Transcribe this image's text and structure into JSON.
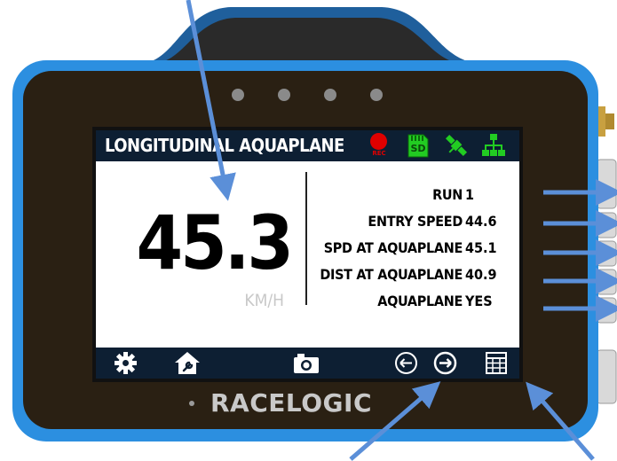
{
  "device": {
    "brand": "RACELOGIC",
    "colors": {
      "shell": "#2c8fe0",
      "bezel": "#2a2013",
      "screen_bar": "#0d1f33",
      "arrow": "#5b8fd8"
    }
  },
  "screen": {
    "title": "LONGITUDINAL AQUAPLANE",
    "status_icons": {
      "rec_label": "REC",
      "sd_label": "SD",
      "rec_color": "#e00000",
      "ok_color": "#22cc22"
    },
    "speed": {
      "value": "45.3",
      "unit": "KM/H"
    },
    "results": [
      {
        "key": "RUN",
        "value": "1"
      },
      {
        "key": "ENTRY SPEED",
        "value": "44.6"
      },
      {
        "key": "SPD AT AQUAPLANE",
        "value": "45.1"
      },
      {
        "key": "DIST AT AQUAPLANE",
        "value": "40.9"
      },
      {
        "key": "AQUAPLANE",
        "value": "YES"
      }
    ],
    "toolbar": [
      "gear-icon",
      "home-wrench-icon",
      "camera-icon",
      "arrow-left-icon",
      "arrow-right-icon",
      "table-icon"
    ]
  }
}
